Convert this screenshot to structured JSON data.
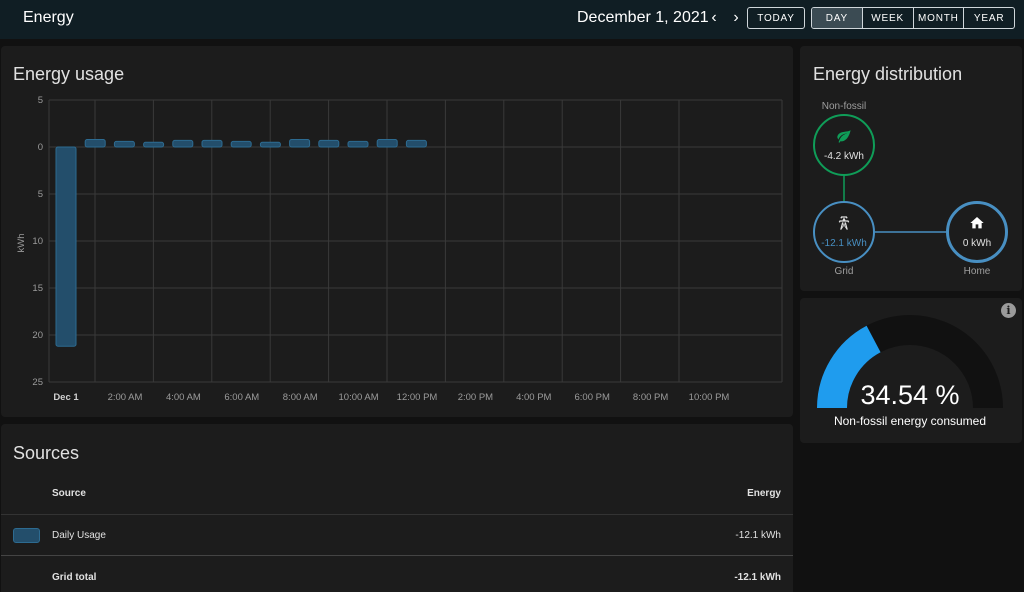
{
  "header": {
    "title": "Energy",
    "date": "December 1, 2021",
    "prev_icon": "chevron-left-icon",
    "next_icon": "chevron-right-icon",
    "today_label": "TODAY",
    "periods": [
      "DAY",
      "WEEK",
      "MONTH",
      "YEAR"
    ],
    "active_period": "DAY"
  },
  "usage_card": {
    "title": "Energy usage"
  },
  "chart_data": {
    "type": "bar",
    "title": "Energy usage",
    "ylabel": "kWh",
    "ylim": [
      25,
      -5
    ],
    "y_ticks": [
      "5",
      "0",
      "5",
      "10",
      "15",
      "20",
      "25"
    ],
    "x_ticks": [
      "Dec 1",
      "2:00 AM",
      "4:00 AM",
      "6:00 AM",
      "8:00 AM",
      "10:00 AM",
      "12:00 PM",
      "2:00 PM",
      "4:00 PM",
      "6:00 PM",
      "8:00 PM",
      "10:00 PM"
    ],
    "grid": true,
    "color": "#234e6b",
    "border_color": "#2d6b91",
    "series": [
      {
        "hours": [
          0,
          1,
          2,
          3,
          4,
          5,
          6,
          7,
          8,
          9,
          10,
          11,
          12
        ],
        "values": [
          21.2,
          -0.8,
          -0.6,
          -0.5,
          -0.7,
          -0.7,
          -0.6,
          -0.5,
          -0.8,
          -0.7,
          -0.6,
          -0.8,
          -0.7
        ]
      }
    ]
  },
  "distribution": {
    "title": "Energy distribution",
    "nonfossil": {
      "label": "Non-fossil",
      "value": "-4.2 kWh",
      "icon": "leaf-icon",
      "color": "#0f9d58"
    },
    "grid": {
      "label": "Grid",
      "value": "-12.1 kWh",
      "icon": "transmission-tower-icon",
      "color": "#488fc2"
    },
    "home": {
      "label": "Home",
      "value": "0 kWh",
      "icon": "home-icon",
      "color": "#488fc2"
    }
  },
  "gauge": {
    "value": "34.54 %",
    "fraction": 0.3454,
    "name": "Non-fossil energy consumed",
    "fill_color": "#1f9cee",
    "track_color": "#111111",
    "info_icon": "info-icon"
  },
  "sources": {
    "title": "Sources",
    "col_source": "Source",
    "col_energy": "Energy",
    "rows": [
      {
        "name": "Daily Usage",
        "energy": "-12.1 kWh"
      }
    ],
    "total_label": "Grid total",
    "total_value": "-12.1 kWh"
  }
}
